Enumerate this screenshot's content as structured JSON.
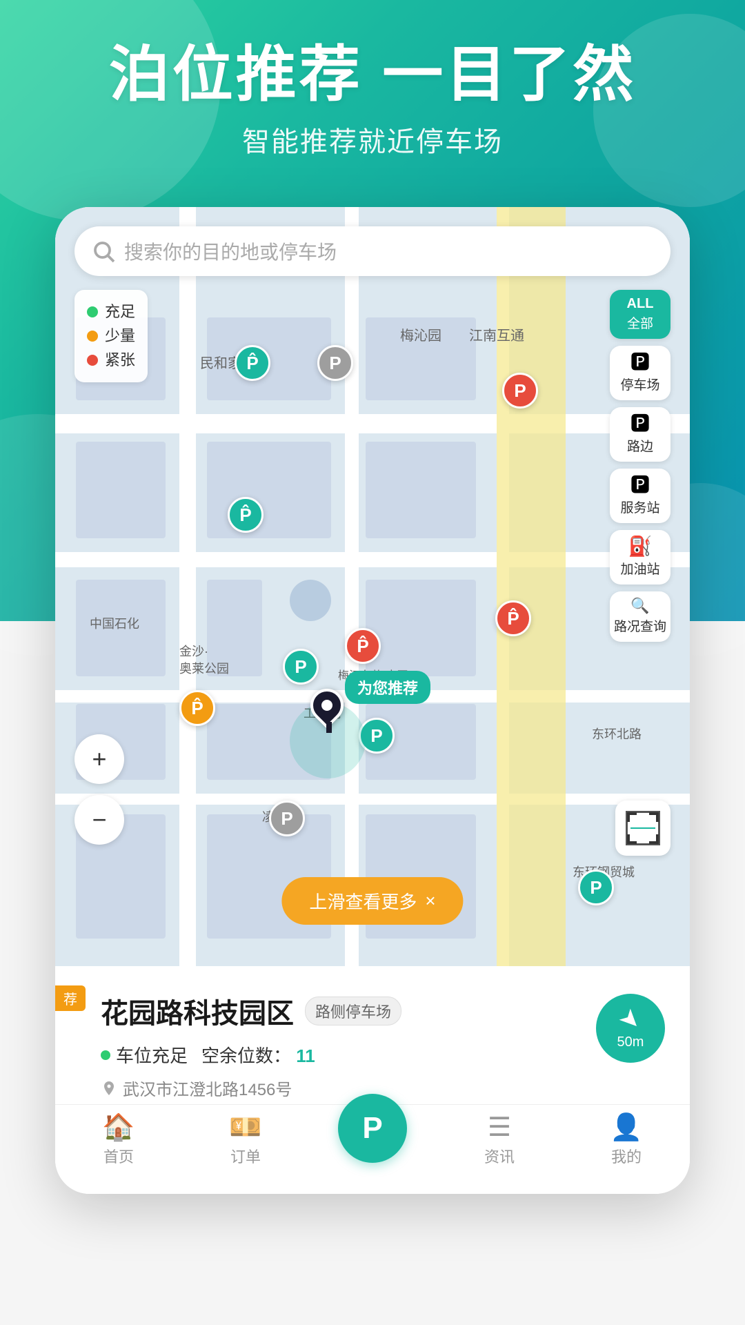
{
  "hero": {
    "title": "泊位推荐 一目了然",
    "subtitle": "智能推荐就近停车场"
  },
  "search": {
    "placeholder": "搜索你的目的地或停车场"
  },
  "legend": {
    "items": [
      {
        "label": "充足",
        "color": "green"
      },
      {
        "label": "少量",
        "color": "yellow"
      },
      {
        "label": "紧张",
        "color": "red"
      }
    ]
  },
  "right_panel": {
    "buttons": [
      {
        "label": "全部",
        "icon": "ALL",
        "active": true
      },
      {
        "label": "停车场",
        "icon": "P"
      },
      {
        "label": "路边",
        "icon": "P"
      },
      {
        "label": "服务站",
        "icon": "P"
      },
      {
        "label": "加油站",
        "icon": "⛽"
      },
      {
        "label": "路况查询",
        "icon": "🔍"
      }
    ]
  },
  "map": {
    "for_you_label": "为您推荐",
    "labels": [
      "梅沁园",
      "民和家园",
      "江南互通",
      "中国石化",
      "金沙·",
      "奥莱公园",
      "梅江东苑·南区",
      "工南苑",
      "东环北路",
      "凌云路",
      "东环钢贸城"
    ]
  },
  "slide_btn": {
    "label": "上滑查看更多",
    "close": "×"
  },
  "zoom": {
    "plus": "+",
    "minus": "−"
  },
  "bottom_card": {
    "tag": "荐",
    "name": "花园路科技园区",
    "badge": "路侧停车场",
    "status": "车位充足",
    "spaces_label": "空余位数：",
    "spaces_num": "11",
    "address": "武汉市江澄北路1456号",
    "nav_distance": "50m"
  },
  "bottom_nav": {
    "items": [
      {
        "label": "首页",
        "icon": "🏠"
      },
      {
        "label": "订单",
        "icon": "💴"
      },
      {
        "label": "",
        "icon": "P",
        "center": true
      },
      {
        "label": "资讯",
        "icon": "☰"
      },
      {
        "label": "我的",
        "icon": "👤"
      }
    ]
  }
}
